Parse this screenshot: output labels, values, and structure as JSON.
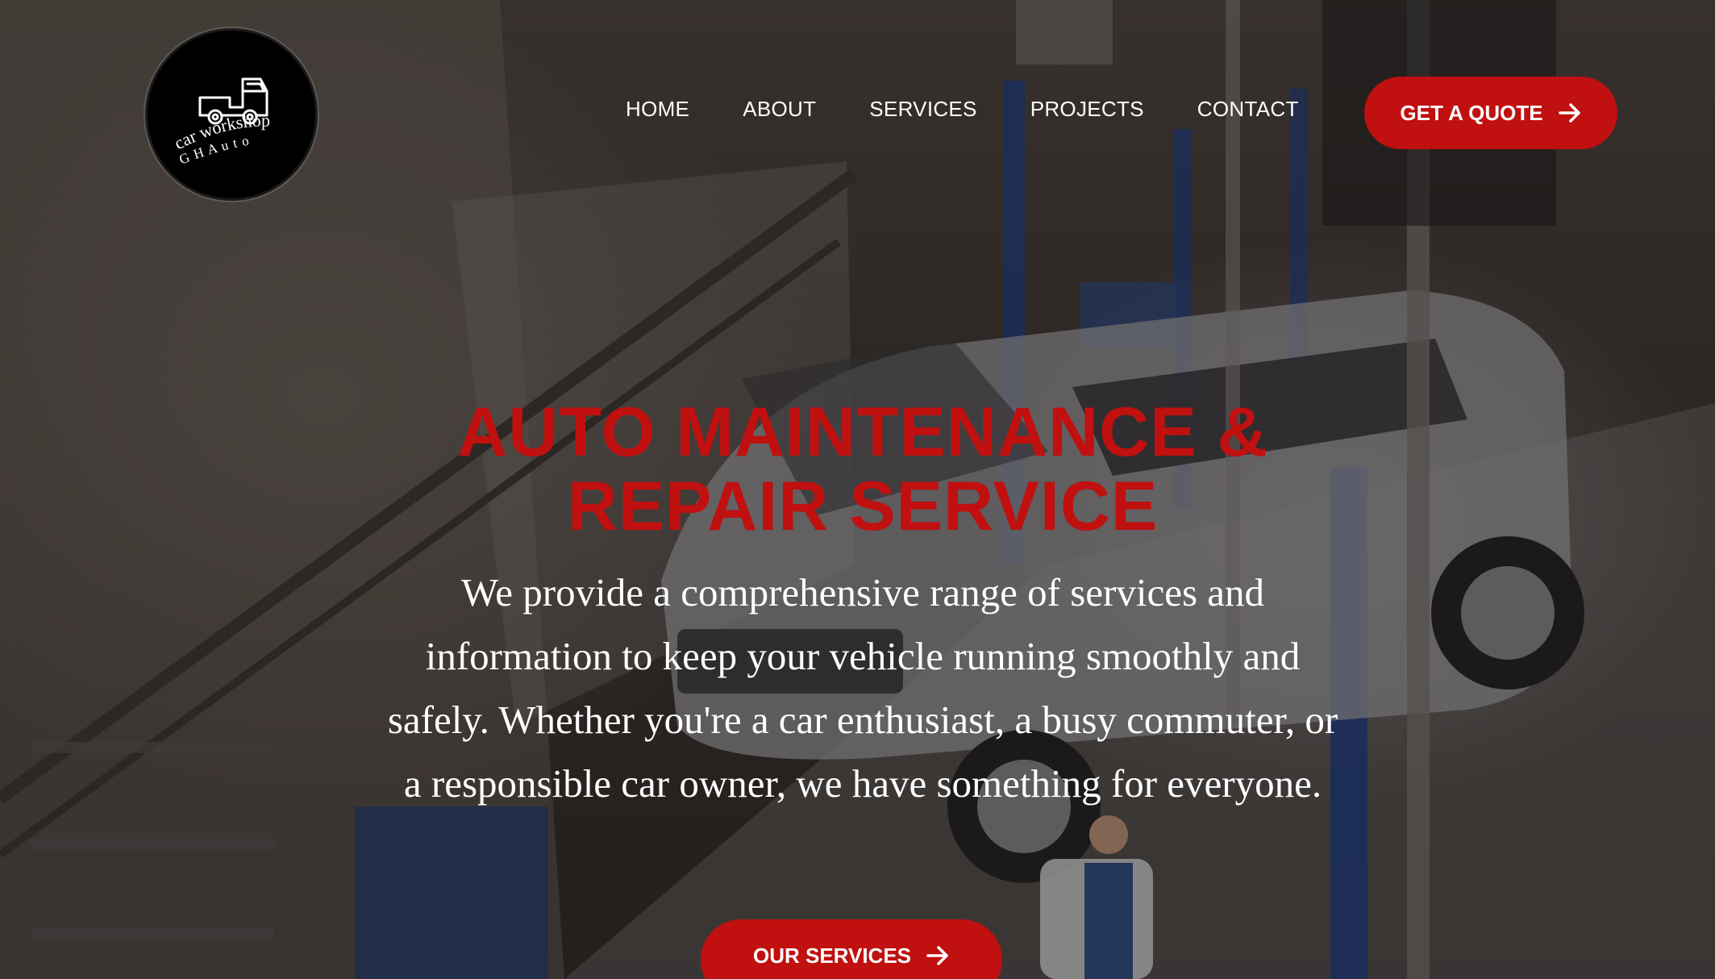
{
  "logo": {
    "line1": "car workshop",
    "line2": "G H   A u t o",
    "icon": "truck-icon"
  },
  "nav": {
    "items": [
      {
        "label": "HOME"
      },
      {
        "label": "ABOUT"
      },
      {
        "label": "SERVICES"
      },
      {
        "label": "PROJECTS"
      },
      {
        "label": "CONTACT"
      }
    ],
    "cta_label": "GET A QUOTE",
    "cta_icon": "arrow-right-icon"
  },
  "hero": {
    "title_line1": "AUTO MAINTENANCE &",
    "title_line2": "REPAIR SERVICE",
    "description": "We provide a comprehensive range of services and information to keep your vehicle running smoothly and safely. Whether you're a car enthusiast, a busy commuter, or a responsible car owner, we have something for everyone.",
    "button_label": "OUR SERVICES",
    "button_icon": "arrow-right-icon"
  },
  "colors": {
    "accent": "#c0100f",
    "text": "#ffffff",
    "logo_bg": "#000000"
  }
}
